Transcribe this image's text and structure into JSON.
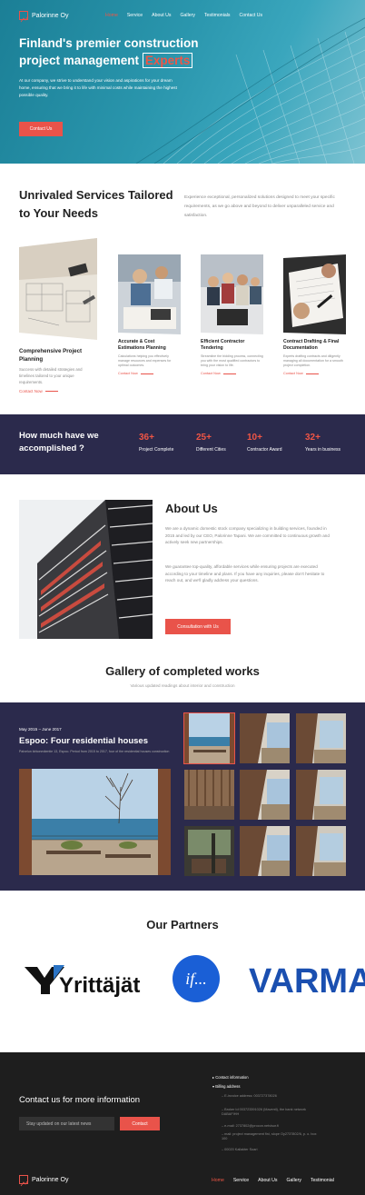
{
  "brand": {
    "name": "Palorinne Oy"
  },
  "nav": {
    "items": [
      "Home",
      "Service",
      "About Us",
      "Gallery",
      "Testimonials",
      "Contact Us"
    ],
    "active": "Home"
  },
  "hero": {
    "title_line1": "Finland's premier construction",
    "title_line2": "project management",
    "title_highlight": "Experts",
    "description": "At our company, we strive to understand your vision and aspirations for your dream home, ensuring that we bring it to life with minimal costs while maintaining the highest possible quality.",
    "cta": "Contact Us"
  },
  "services": {
    "title": "Unrivaled Services Tailored to Your Needs",
    "description": "Experience exceptional, personalized solutions designed to meet your specific requirements, as we go above and beyond to deliver unparalleled service and satisfaction.",
    "cards": [
      {
        "title": "Comprehensive Project Planning",
        "desc": "Success with detailed strategies and timelines tailored to your unique requirements.",
        "more": "Contact Now"
      },
      {
        "title": "Accurate & Cost Estimations Planning",
        "desc": "Calculations helping you effectively manage resources and expenses for optimal outcomes.",
        "more": "Contact Now"
      },
      {
        "title": "Efficient Contractor Tendering",
        "desc": "Streamline the bidding process, connecting you with the most qualified contractors to bring your vision to life.",
        "more": "Contact Now"
      },
      {
        "title": "Contract Drafting & Final Documentation",
        "desc": "Experts drafting contracts and diligently managing all documentation for a smooth project completion.",
        "more": "Contact Now"
      }
    ]
  },
  "stats": {
    "title": "How much have we accomplished ?",
    "items": [
      {
        "value": "36+",
        "label": "Project Complete"
      },
      {
        "value": "25+",
        "label": "Different Cities"
      },
      {
        "value": "10+",
        "label": "Contractor Award"
      },
      {
        "value": "32+",
        "label": "Years in business"
      }
    ]
  },
  "about": {
    "title": "About Us",
    "p1": "We are a dynamic domestic stock company specializing in building services, founded in 2015 and led by our CEO, Palorinne Tapani. We are committed to continuous growth and actively seek new partnerships.",
    "p2": "We guarantee top-quality, affordable services while ensuring projects are executed according to your timeline and plans. If you have any inquiries, please don't hesitate to reach out, and we'll gladly address your questions.",
    "cta": "Consultation with Us"
  },
  "gallery": {
    "title": "Gallery of completed works",
    "subtitle": "Various updated readings about interior and construction",
    "date": "May 2015 – June 2017",
    "name": "Espoo: Four residential houses",
    "desc": "Palvelun kirkonmäentie 13, Espoo. Period from 2015 to 2017, four of the residential houses construction"
  },
  "partners": {
    "title": "Our Partners",
    "logos": [
      "Yrittäjät",
      "if...",
      "VARMA"
    ]
  },
  "footer": {
    "contact_title": "Contact us for more information",
    "input_placeholder": "Stay updated on our latest news",
    "button": "Contact",
    "info_heading": "Contact information",
    "billing_heading": "Billing address",
    "billing_lines": [
      "E-invoice address: 003727378026",
      "Broker Id 003723391026 (Maventi), the bank network DABAFIHH",
      "e-mail: 2737802@procon.netvisor.fi",
      "mail: project management fini, slope Oy2737802/6, p. o. box 100",
      "00020 Kallakter Soari"
    ],
    "nav": [
      "Home",
      "Service",
      "About Us",
      "Gallery",
      "Testimonial"
    ],
    "nav_active": "Home"
  },
  "colors": {
    "accent": "#e9534a",
    "navy": "#2b2a4c",
    "hero": "#2a96ad",
    "footer": "#1e1e1e"
  }
}
